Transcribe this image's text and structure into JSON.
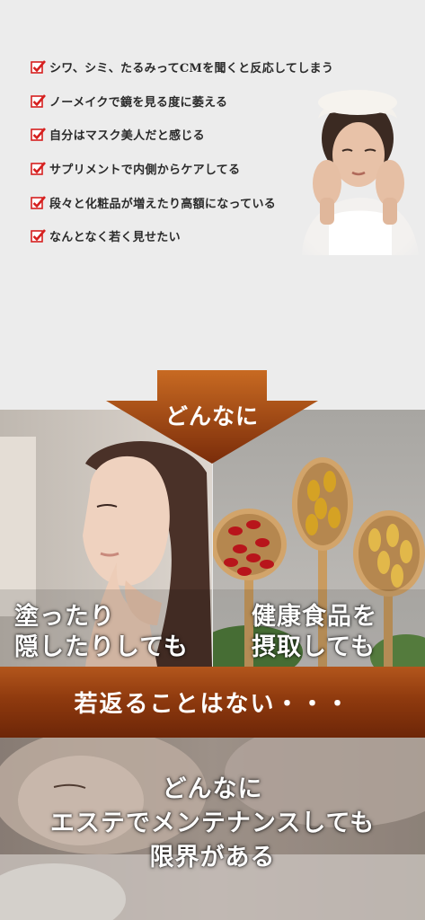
{
  "checklist": {
    "items": [
      "シワ、シミ、たるみってCMを聞くと反応してしまう",
      "ノーメイクで鏡を見る度に萎える",
      "自分はマスク美人だと感じる",
      "サプリメントで内側からケアしてる",
      "段々と化粧品が増えたり高額になっている",
      "なんとなく若く見せたい"
    ],
    "check_icon": "red-checkbox-icon",
    "check_color": "#d6201f"
  },
  "arrow": {
    "label": "どんなに",
    "color": "#9a4510"
  },
  "panels": {
    "left_caption": [
      "塗ったり",
      "隠したりしても"
    ],
    "right_caption": [
      "健康食品を",
      "摂取しても"
    ]
  },
  "band": {
    "text": "若返ることはない・・・",
    "color": "#8f3a0e"
  },
  "bottom": {
    "lines": [
      "どんなに",
      "エステでメンテナンスしても",
      "限界がある"
    ]
  }
}
